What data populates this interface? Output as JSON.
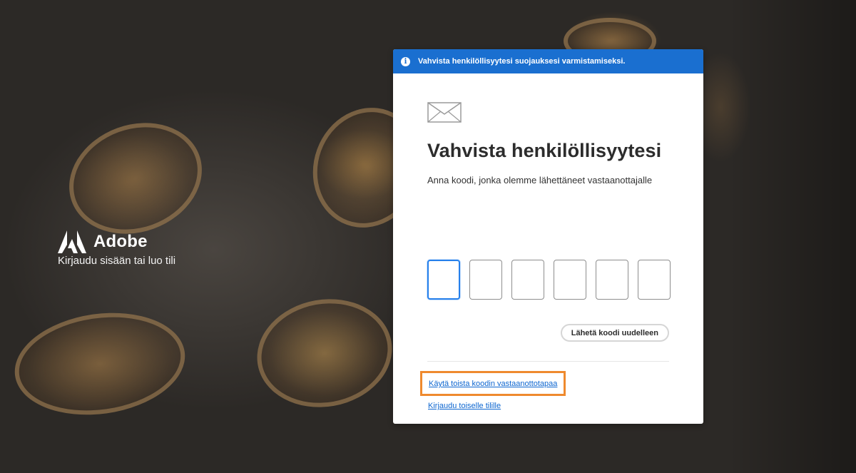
{
  "brand": {
    "name": "Adobe",
    "tagline": "Kirjaudu sisään tai luo tili"
  },
  "banner": {
    "icon": "info-icon",
    "text": "Vahvista henkilöllisyytesi suojauksesi varmistamiseksi.",
    "color": "#1a6fd0"
  },
  "card": {
    "icon": "mail-icon",
    "title": "Vahvista henkilöllisyytesi",
    "subtitle": "Anna koodi, jonka olemme lähettäneet vastaanottajalle",
    "code_digits": [
      "",
      "",
      "",
      "",
      "",
      ""
    ],
    "resend_label": "Lähetä koodi uudelleen",
    "alt_method_link": "Käytä toista koodin vastaanottotapaa",
    "other_account_link": "Kirjaudu toiselle tilille"
  },
  "colors": {
    "highlight_border": "#ef8a2e",
    "link": "#0d66d0",
    "focus": "#2680eb"
  }
}
